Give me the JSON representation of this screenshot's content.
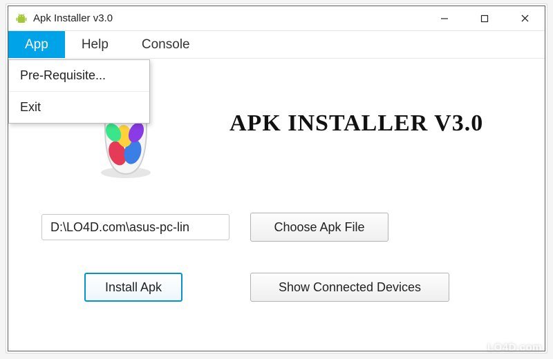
{
  "window": {
    "title": "Apk Installer v3.0"
  },
  "menubar": {
    "items": [
      "App",
      "Help",
      "Console"
    ],
    "active_index": 0
  },
  "dropdown": {
    "items": [
      "Pre-Requisite...",
      "Exit"
    ]
  },
  "content": {
    "heading": "APK INSTALLER V3.0",
    "path_value": "D:\\LO4D.com\\asus-pc-lin",
    "choose_button": "Choose Apk File",
    "install_button": "Install Apk",
    "devices_button": "Show Connected Devices"
  },
  "watermark": "LO4D.com",
  "icons": {
    "app": "android-icon",
    "minimize": "minimize-icon",
    "maximize": "maximize-icon",
    "close": "close-icon"
  },
  "colors": {
    "accent": "#00a2e8",
    "primary_border": "#0590d6"
  }
}
